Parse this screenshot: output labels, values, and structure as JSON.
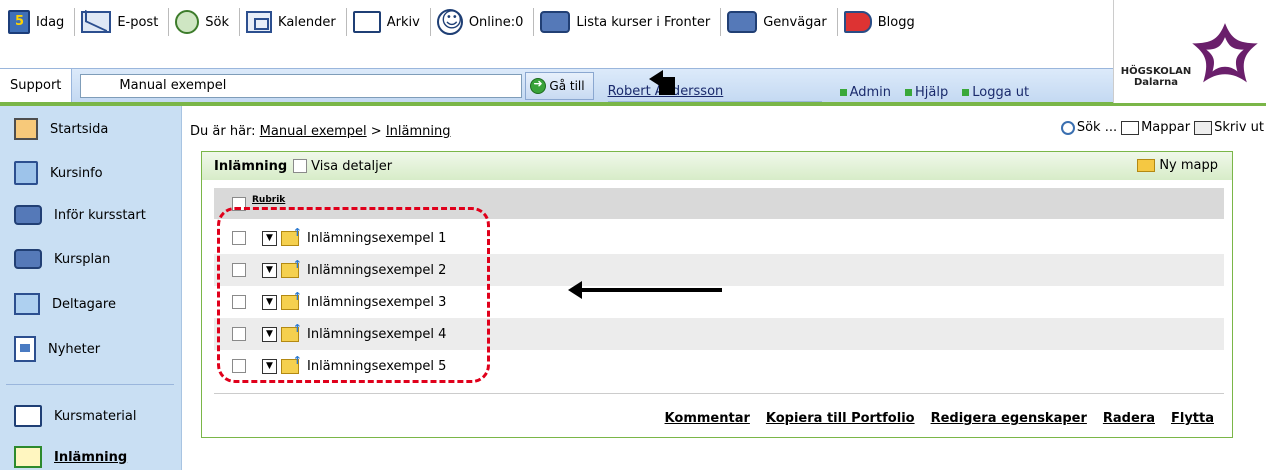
{
  "toolbar": {
    "items": [
      {
        "label": "Idag",
        "icon": "calendar-day-icon"
      },
      {
        "label": "E-post",
        "icon": "mail-icon"
      },
      {
        "label": "Sök",
        "icon": "people-search-icon"
      },
      {
        "label": "Kalender",
        "icon": "calendar-icon"
      },
      {
        "label": "Arkiv",
        "icon": "folder-icon"
      },
      {
        "label": "Online:0",
        "icon": "smiley-icon"
      },
      {
        "label": "Lista kurser i Fronter",
        "icon": "link-icon"
      },
      {
        "label": "Genvägar",
        "icon": "shortcut-icon"
      },
      {
        "label": "Blogg",
        "icon": "megaphone-icon"
      }
    ]
  },
  "logo": {
    "line1": "HÖGSKOLAN",
    "line2": "Dalarna"
  },
  "secbar": {
    "tab": "Support",
    "course_select_value": "Manual exempel",
    "goto_label": "Gå till",
    "user": "Robert Andersson",
    "menu": [
      "Admin",
      "Hjälp",
      "Logga ut"
    ]
  },
  "sidebar": {
    "items": [
      {
        "label": "Startsida"
      },
      {
        "label": "Kursinfo"
      },
      {
        "label": "Inför kursstart"
      },
      {
        "label": "Kursplan"
      },
      {
        "label": "Deltagare"
      },
      {
        "label": "Nyheter"
      },
      {
        "label": "Kursmaterial"
      },
      {
        "label": "Inlämning"
      }
    ]
  },
  "breadcrumb": {
    "prefix": "Du är här:",
    "root": "Manual exempel",
    "separator": ">",
    "current": "Inlämning"
  },
  "tools": {
    "search": "Sök ...",
    "folders": "Mappar",
    "print": "Skriv ut"
  },
  "panel": {
    "title": "Inlämning",
    "details_label": "Visa detaljer",
    "new_folder": "Ny mapp",
    "column_header": "Rubrik",
    "rows": [
      "Inlämningsexempel 1",
      "Inlämningsexempel 2",
      "Inlämningsexempel 3",
      "Inlämningsexempel 4",
      "Inlämningsexempel 5"
    ],
    "actions": [
      "Kommentar",
      "Kopiera till Portfolio",
      "Redigera egenskaper",
      "Radera",
      "Flytta"
    ]
  },
  "colors": {
    "accent_green": "#7ab648",
    "sidebar_bg": "#c9dff3",
    "annotation_red": "#e0001b"
  }
}
